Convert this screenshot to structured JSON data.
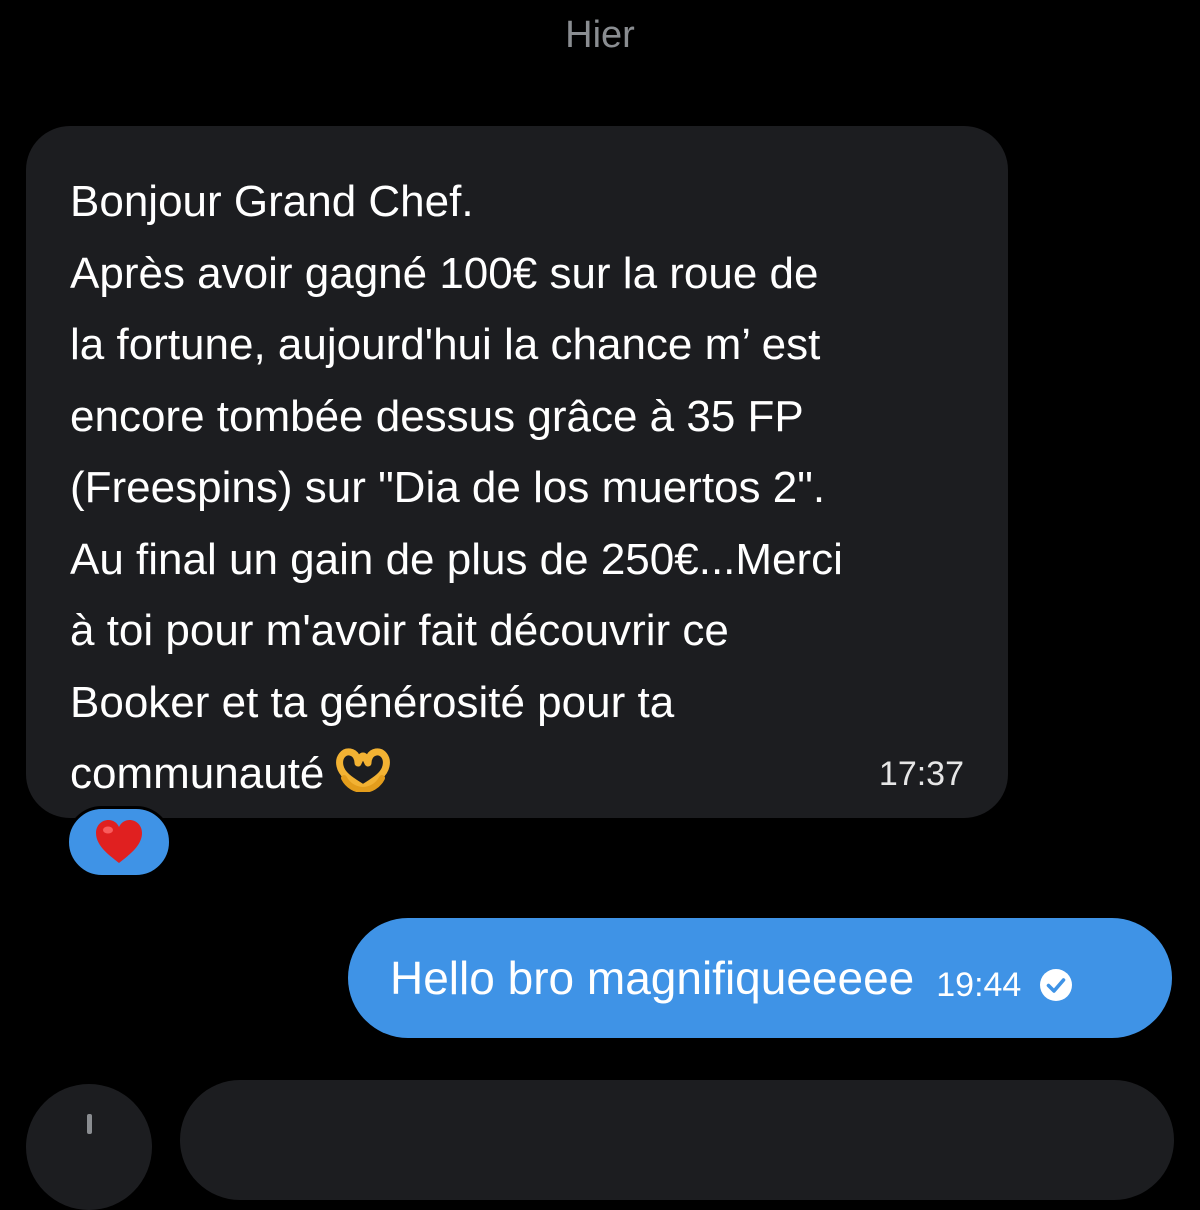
{
  "day_separator": "Hier",
  "incoming_message": {
    "lines": [
      "Bonjour Grand Chef.",
      "Après avoir gagné 100€ sur la roue de",
      "la fortune, aujourd'hui la chance m’ est",
      "encore tombée dessus grâce à 35 FP",
      "(Freespins) sur \"Dia de los muertos 2\".",
      "Au final un gain de plus de 250€...Merci",
      "à toi pour m'avoir fait découvrir ce",
      "Booker et ta générosité pour ta",
      "communauté"
    ],
    "emoji": "heart-hands-emoji",
    "time": "17:37",
    "reaction": "red-heart-emoji"
  },
  "outgoing_message": {
    "text": "Hello bro magnifiqueeeee",
    "time": "19:44",
    "status_icon": "read-check-icon"
  },
  "colors": {
    "background": "#000000",
    "incoming_bubble": "#1c1d20",
    "outgoing_bubble": "#3f93e6",
    "muted_text": "#8a8d91"
  }
}
